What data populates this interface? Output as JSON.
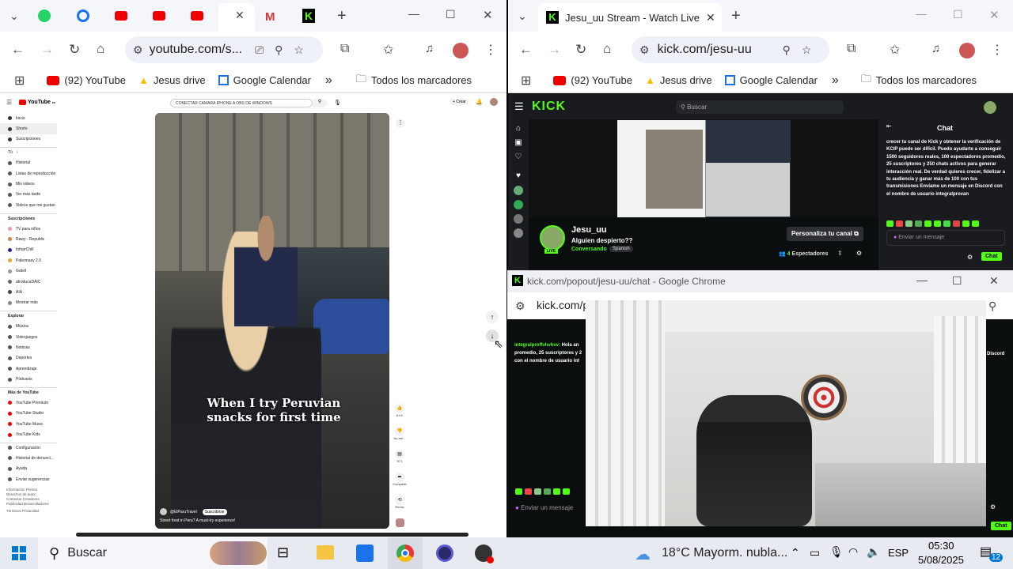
{
  "left_browser": {
    "tabs": [
      {
        "icon": "whatsapp-icon",
        "color": "#25d366"
      },
      {
        "icon": "app-icon",
        "color": "#1a73e8"
      },
      {
        "icon": "youtube-icon",
        "color": "#e00"
      },
      {
        "icon": "youtube-icon",
        "color": "#e00"
      },
      {
        "icon": "youtube-icon",
        "color": "#e00"
      },
      {
        "icon": "active-tab",
        "color": "#fff"
      },
      {
        "icon": "gmail-icon",
        "color": "#d33"
      },
      {
        "icon": "kick-icon",
        "color": "#53fc18"
      }
    ],
    "new_tab": "+",
    "url": "youtube.com/s...",
    "bookmarks": [
      "(92) YouTube",
      "Jesus drive",
      "Google Calendar"
    ],
    "bookmarks_more": "»",
    "all_bookmarks": "Todos los marcadores"
  },
  "youtube": {
    "logo": "YouTube",
    "logo_sup": "PE",
    "search": "CONECTAR CAMARA IPHONE A OBS DE WINDOWS",
    "create": "+ Crear",
    "sidebar_main": [
      "Inicio",
      "Shorts",
      "Suscripciones"
    ],
    "sidebar_tu_header": "Tú",
    "sidebar_tu": [
      "Historial",
      "Listas de reproducción",
      "Mis videos",
      "Ver más tarde",
      "Videos que me gustan"
    ],
    "subs_header": "Suscripciones",
    "subs": [
      "TV para niños",
      "Rawy - Republic",
      "InfoprChill",
      "Palermasy 2.0",
      "Gatell",
      "afroducaDAIC",
      "AIA",
      "Mostrar más"
    ],
    "explore_header": "Explorar",
    "explore": [
      "Música",
      "Videojuegos",
      "Noticias",
      "Deportes",
      "Aprendizaje",
      "Pódcasts"
    ],
    "more_header": "Más de YouTube",
    "more": [
      "YouTube Premium",
      "YouTube Studio",
      "YouTube Music",
      "YouTube Kids"
    ],
    "settings": [
      "Configuración",
      "Historial de denunci...",
      "Ayuda",
      "Enviar sugerencias"
    ],
    "footer": "Información  Prensa  Derechos de autor  Contactar  Creadores  Publicidad  Desarrolladores",
    "footer2": "Términos  Privacidad",
    "short_caption": "When I try Peruvian snacks for first time",
    "channel": "@ElParuTravel",
    "subscribe": "Suscribirse",
    "short_desc": "Street food in Peru? A must-try experience!",
    "actions": [
      {
        "icon": "like-icon",
        "label": "61 K"
      },
      {
        "icon": "dislike-icon",
        "label": "No me..."
      },
      {
        "icon": "comment-icon",
        "label": "571"
      },
      {
        "icon": "share-icon",
        "label": "Compartir"
      },
      {
        "icon": "remix-icon",
        "label": "Remix"
      }
    ]
  },
  "right_browser": {
    "tab_title": "Jesu_uu Stream - Watch Live on",
    "url": "kick.com/jesu-uu",
    "bookmarks": [
      "(92) YouTube",
      "Jesus drive",
      "Google Calendar"
    ],
    "bookmarks_more": "»",
    "all_bookmarks": "Todos los marcadores"
  },
  "kick": {
    "logo": "KICK",
    "search": "Buscar",
    "streamer": "Jesu_uu",
    "title": "Alguien despierto??",
    "category": "Conversando",
    "tag": "Spanish",
    "live": "LIVE",
    "customize": "Personaliza tu canal",
    "viewers_count": "4",
    "viewers_label": "Espectadores",
    "chat_title": "Chat",
    "chat_text": "crecer tu canal de Kick y obtener la verificación de KCIP puede ser difícil. Puedo ayudarte a conseguir 1500 seguidores reales, 100 espectadores promedio, 25 suscriptores y 250 chats activos para generar interacción real. De verdad quieres crecer, fidelizar a tu audiencia y ganar más de 100 con tus transmisiones Envíame un mensaje en Discord con el nombre de usuario integralprovan",
    "chat_placeholder": "Enviar un mensaje",
    "chat_button": "Chat"
  },
  "popout": {
    "title": "kick.com/popout/jesu-uu/chat - Google Chrome",
    "url": "kick.com/p",
    "chat_user": "integralproffvhvhvv:",
    "chat_line1": " Hola an",
    "chat_line2": "promedio, 25 suscriptores y 2",
    "chat_line3": "con el nombre de usuario int",
    "right_snip": "Discord",
    "placeholder": "Enviar un mensaje",
    "chat_button": "Chat"
  },
  "taskbar": {
    "search": "Buscar",
    "weather": "18°C  Mayorm. nubla...",
    "lang": "ESP",
    "time": "05:30",
    "date": "5/08/2025",
    "notifications": "12"
  }
}
